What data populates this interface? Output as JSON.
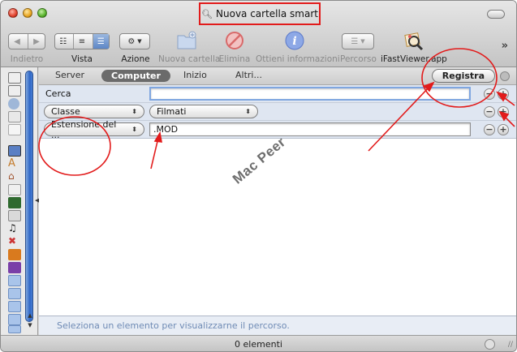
{
  "window": {
    "title": "Nuova cartella smart"
  },
  "toolbar": {
    "back_label": "Indietro",
    "view_label": "Vista",
    "action_label": "Azione",
    "new_folder_label": "Nuova cartella",
    "delete_label": "Elimina",
    "info_label": "Ottieni informazioni",
    "path_label": "Percorso",
    "app_label": "iFastViewer.app"
  },
  "scopebar": {
    "scopes": [
      "Server",
      "Computer",
      "Inizio",
      "Altri..."
    ],
    "active": "Computer",
    "save_label": "Registra"
  },
  "criteria": {
    "search_label": "Cerca",
    "search_value": "",
    "row2_attribute": "Classe",
    "row2_value": "Filmati",
    "row3_attribute": "Estensione del ...",
    "row3_value": ".MOD"
  },
  "pathbar": {
    "hint": "Seleziona un elemento per visualizzarne il percorso."
  },
  "status": {
    "count": "0 elementi"
  },
  "watermark": "Mac Peer",
  "colors": {
    "annotation_red": "#e21b1b",
    "sidebar_blue": "#2f66c6",
    "path_text": "#6f8bb5"
  }
}
